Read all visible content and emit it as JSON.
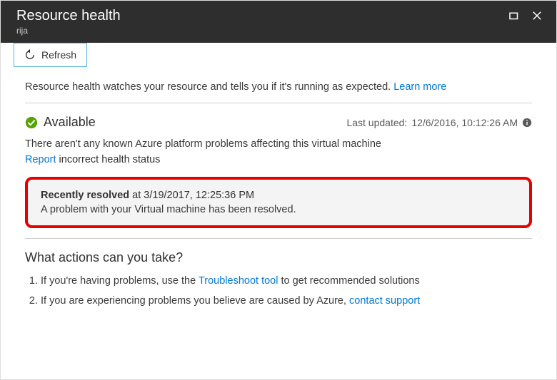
{
  "header": {
    "title": "Resource health",
    "subtitle": "rija"
  },
  "toolbar": {
    "refresh_label": "Refresh"
  },
  "intro": {
    "text": "Resource health watches your resource and tells you if it's running as expected. ",
    "learn_more": "Learn more"
  },
  "status": {
    "label": "Available",
    "last_updated_prefix": "Last updated: ",
    "last_updated_value": "12/6/2016, 10:12:26 AM"
  },
  "problem_desc": "There aren't any known Azure platform problems affecting this virtual machine",
  "report": {
    "link": "Report",
    "text": " incorrect health status"
  },
  "resolved": {
    "label": "Recently resolved",
    "at_prefix": " at ",
    "timestamp": "3/19/2017, 12:25:36 PM",
    "message": "A problem with your Virtual machine has been resolved."
  },
  "actions": {
    "heading": "What actions can you take?",
    "items": [
      {
        "pre": "If you're having problems, use the ",
        "link": "Troubleshoot tool",
        "post": " to get recommended solutions"
      },
      {
        "pre": "If you are experiencing problems you believe are caused by Azure, ",
        "link": "contact support",
        "post": ""
      }
    ]
  }
}
